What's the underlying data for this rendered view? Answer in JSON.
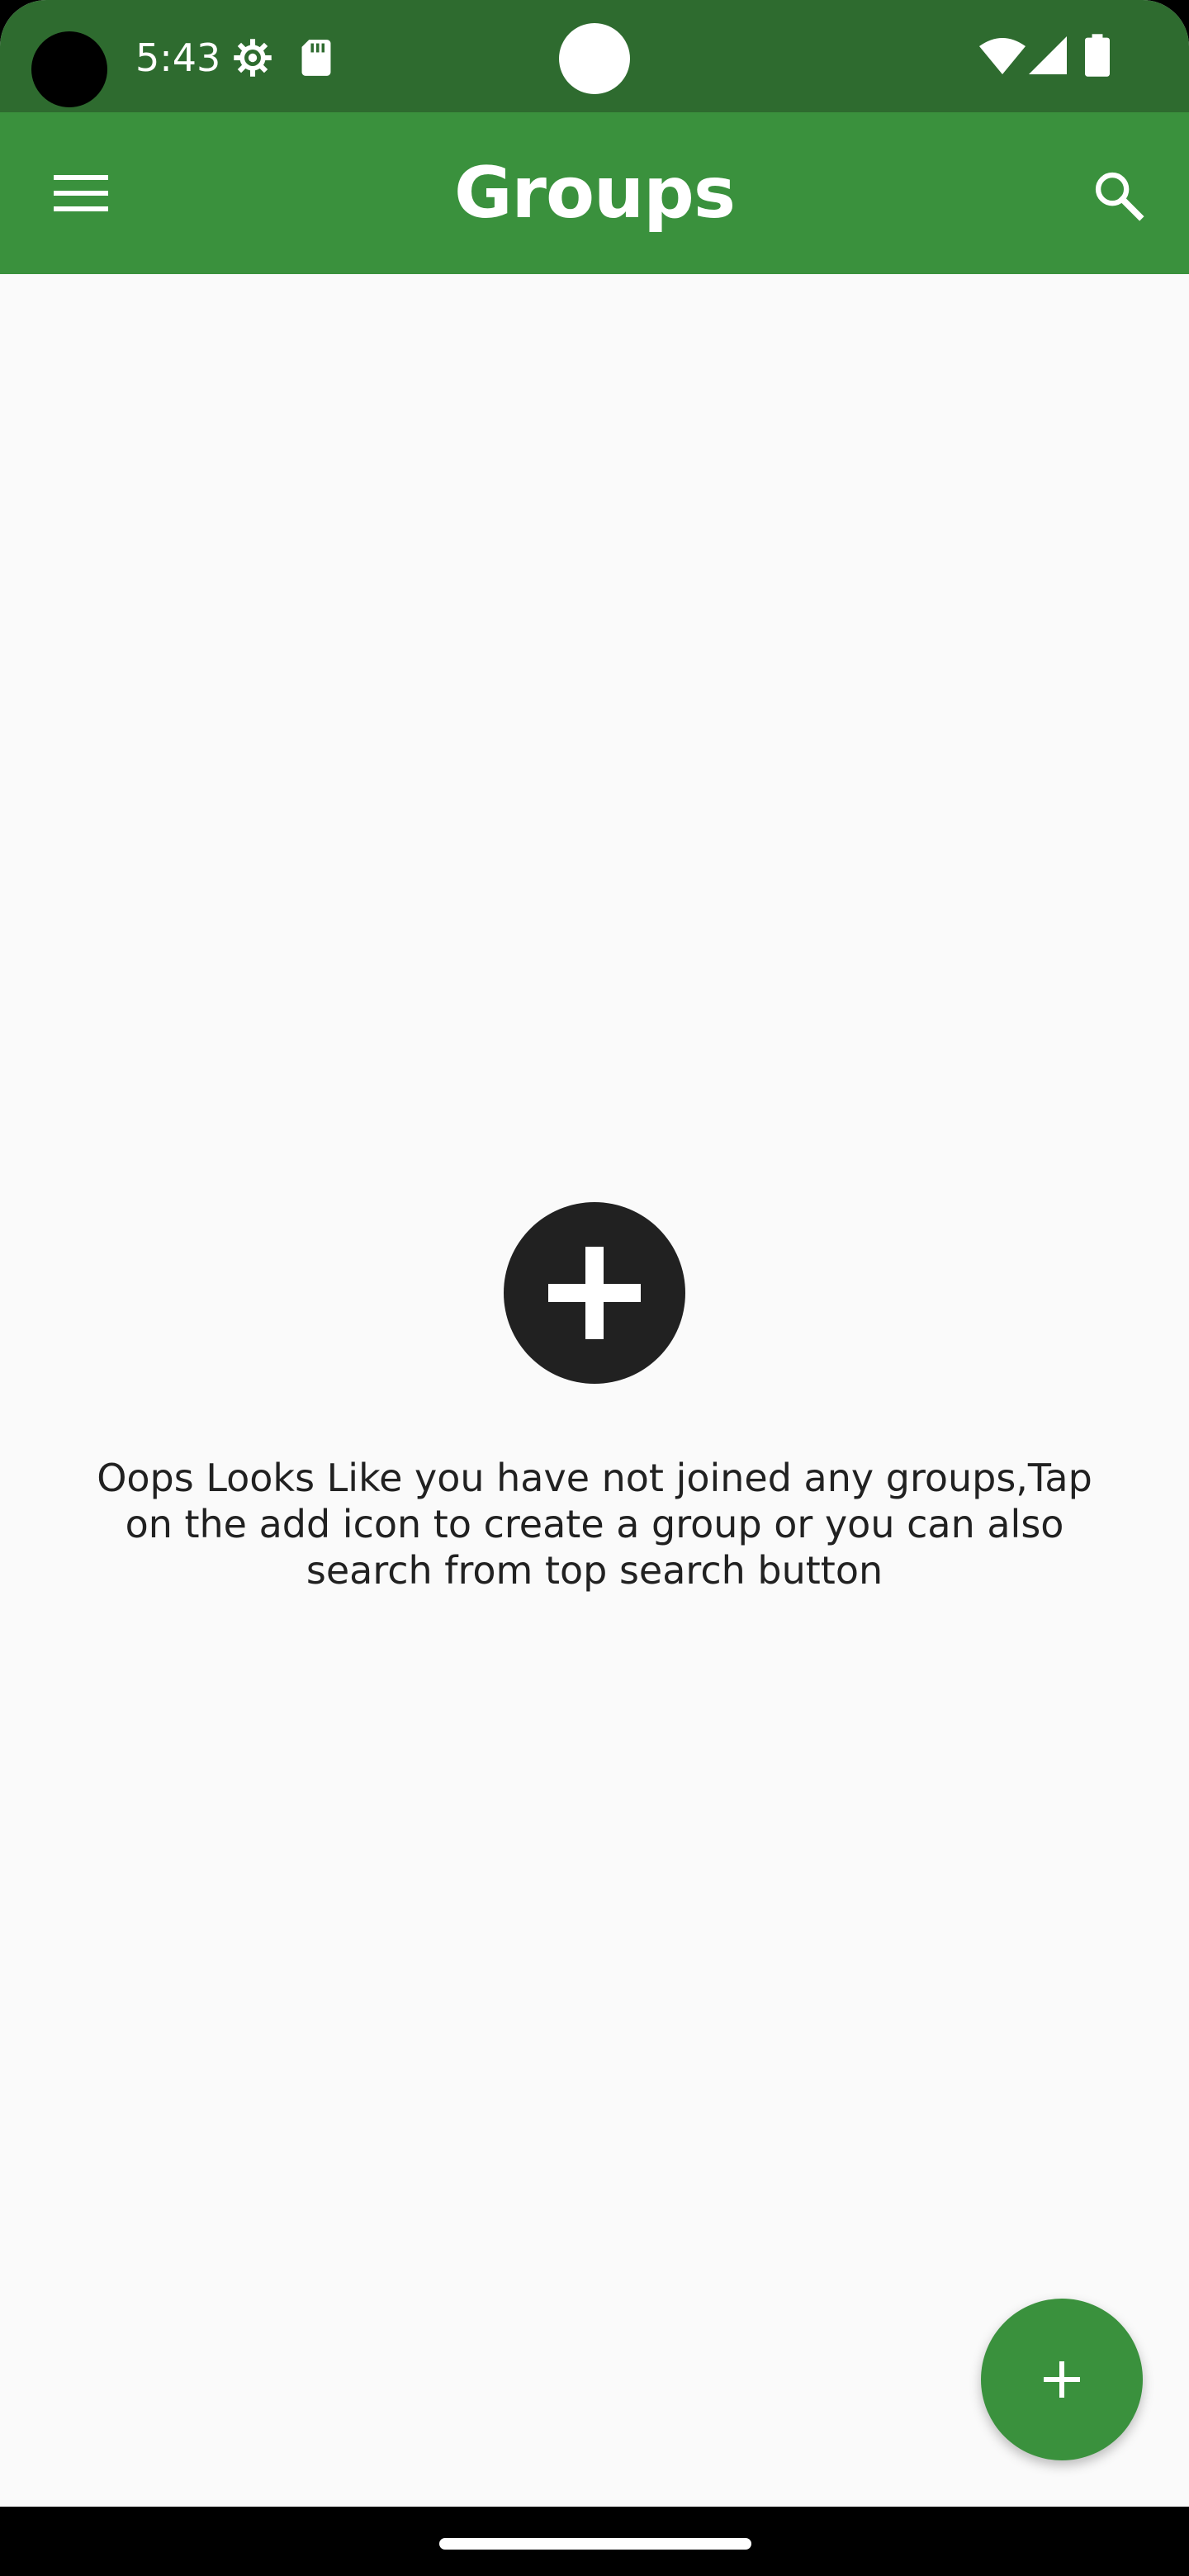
{
  "status_bar": {
    "time": "5:43",
    "icons": [
      "settings-icon",
      "sd-card-icon",
      "wifi-icon",
      "cell-signal-icon",
      "battery-icon"
    ]
  },
  "app_bar": {
    "title": "Groups",
    "menu_icon": "hamburger-menu-icon",
    "search_icon": "search-icon"
  },
  "empty_state": {
    "icon": "add-circle-icon",
    "message": "Oops Looks Like you have not joined any groups,Tap on the add icon to create a group or you can also search from top search button"
  },
  "fab": {
    "icon": "plus-icon"
  },
  "colors": {
    "status_bar": "#2e6b2f",
    "app_bar": "#3a913d",
    "background": "#fafafa",
    "text": "#212121"
  }
}
